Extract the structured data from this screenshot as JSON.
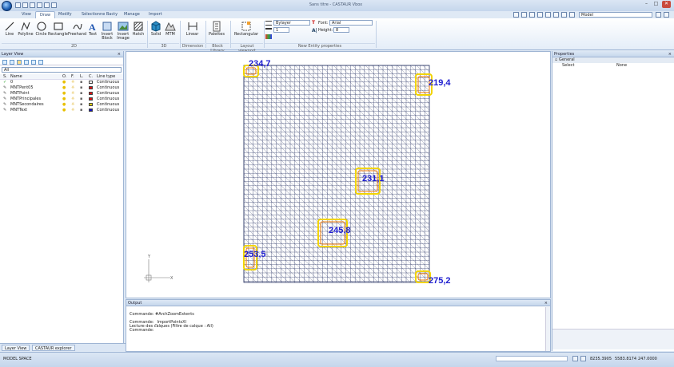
{
  "window": {
    "title": "Sans titre - CASTAUR Vbox",
    "controls": [
      "–",
      "□",
      "✕"
    ]
  },
  "ribbon_tabs": [
    "View",
    "Draw",
    "Modify",
    "Sélectionne Bacty",
    "Manage",
    "Import"
  ],
  "active_tab": "Draw",
  "right_toolbar": {
    "model_combo": "Model"
  },
  "ribbon": {
    "draw_tools": [
      "Line",
      "Polyline",
      "Circle",
      "Rectangle",
      "Freehand",
      "Text",
      "Insert\nBlock",
      "Insert\nImage",
      "Hatch"
    ],
    "draw_group": "2D",
    "tools_3d": [
      "Solid",
      "MTM"
    ],
    "group_3d": "3D",
    "dimension_tool": "Linear",
    "dimension_group": "Dimension",
    "block_tool": "Palettes",
    "block_group": "Block Library",
    "layout_tool": "Rectangular",
    "layout_group": "Layout viewport",
    "entity_props": {
      "layer": "Bylayer",
      "lineweight": "1",
      "font_label": "Font:",
      "font": "Arial",
      "height_label": "Height:",
      "height": "8",
      "group": "New Entity properties"
    }
  },
  "layer_panel": {
    "title": "Layer View",
    "filter": "All",
    "columns": [
      "S.",
      "Name",
      "O.",
      "F.",
      "L.",
      "C.",
      "Line type"
    ],
    "rows": [
      {
        "status": "✓",
        "name": "0",
        "color": "#ffffff",
        "linetype": "Continuous"
      },
      {
        "status": "✎",
        "name": "MNTPent05",
        "color": "#e01010",
        "linetype": "Continuous"
      },
      {
        "status": "✎",
        "name": "MNTPoint",
        "color": "#e01010",
        "linetype": "Continuous"
      },
      {
        "status": "✎",
        "name": "MNTPrincipales",
        "color": "#e01010",
        "linetype": "Continuous"
      },
      {
        "status": "✎",
        "name": "MNTSecondaires",
        "color": "#e0d010",
        "linetype": "Continuous"
      },
      {
        "status": "✎",
        "name": "MNTText",
        "color": "#1010c0",
        "linetype": "Continuous"
      }
    ]
  },
  "bottom_tabs": [
    "Layer View",
    "CASTAUR explorer"
  ],
  "drawing": {
    "labels": [
      "234,7",
      "219,4",
      "231,1",
      "245,8",
      "253,5",
      "275,2"
    ],
    "axis_y": "Y",
    "axis_x": "X"
  },
  "output_panel": {
    "title": "Output",
    "lines": [
      "Commande: #ArchZoomExtents",
      "",
      "Commande: _ImportPointsXl",
      "Lecture des calques (Filtre de calque : All)",
      "Commande:"
    ]
  },
  "properties_panel": {
    "title": "Properties",
    "section": "General",
    "rows": [
      {
        "key": "Select",
        "value": "None"
      }
    ]
  },
  "status_bar": {
    "space": "MODEL SPACE",
    "coords": [
      "8235.3905",
      "5583.8174",
      "247.0000"
    ]
  },
  "colors": {
    "grid": "#1e2a5c",
    "label_text": "#1e1ed0",
    "contour_orange": "#f07800",
    "contour_yellow": "#f2d400"
  }
}
